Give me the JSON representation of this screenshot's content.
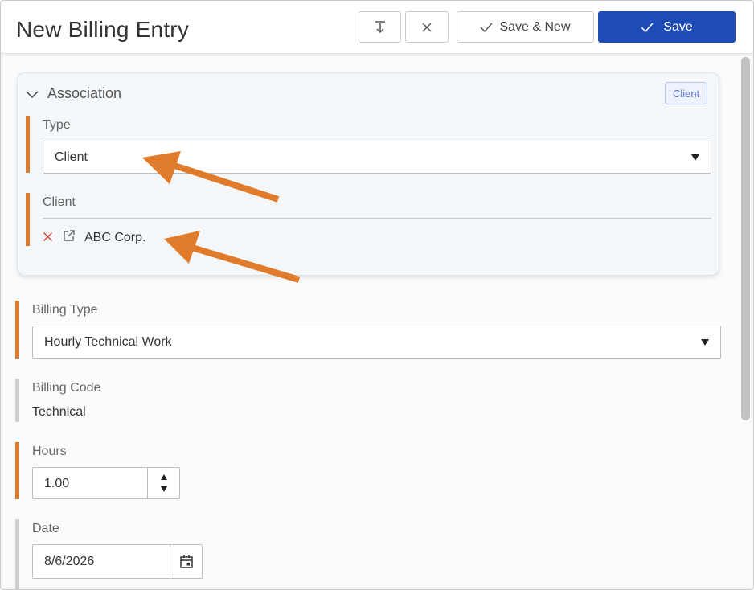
{
  "header": {
    "title": "New Billing Entry",
    "save_new_label": "Save & New",
    "save_label": "Save"
  },
  "association": {
    "title": "Association",
    "badge": "Client",
    "type_label": "Type",
    "type_value": "Client",
    "client_label": "Client",
    "client_value": "ABC Corp."
  },
  "form": {
    "billing_type_label": "Billing Type",
    "billing_type_value": "Hourly Technical Work",
    "billing_code_label": "Billing Code",
    "billing_code_value": "Technical",
    "hours_label": "Hours",
    "hours_value": "1.00",
    "date_label": "Date",
    "date_value": "8/6/2026"
  },
  "colors": {
    "primary": "#1e4bb5",
    "required_marker": "#d97a2e",
    "optional_marker": "#cfcfcf",
    "annotation_arrow": "#e07b2c",
    "remove_icon": "#d2473e"
  },
  "icons": [
    "collapse-icon",
    "close-icon",
    "check-icon",
    "chevron-down-icon",
    "remove-icon",
    "external-link-icon",
    "calendar-icon",
    "spin-up-icon",
    "spin-down-icon"
  ]
}
